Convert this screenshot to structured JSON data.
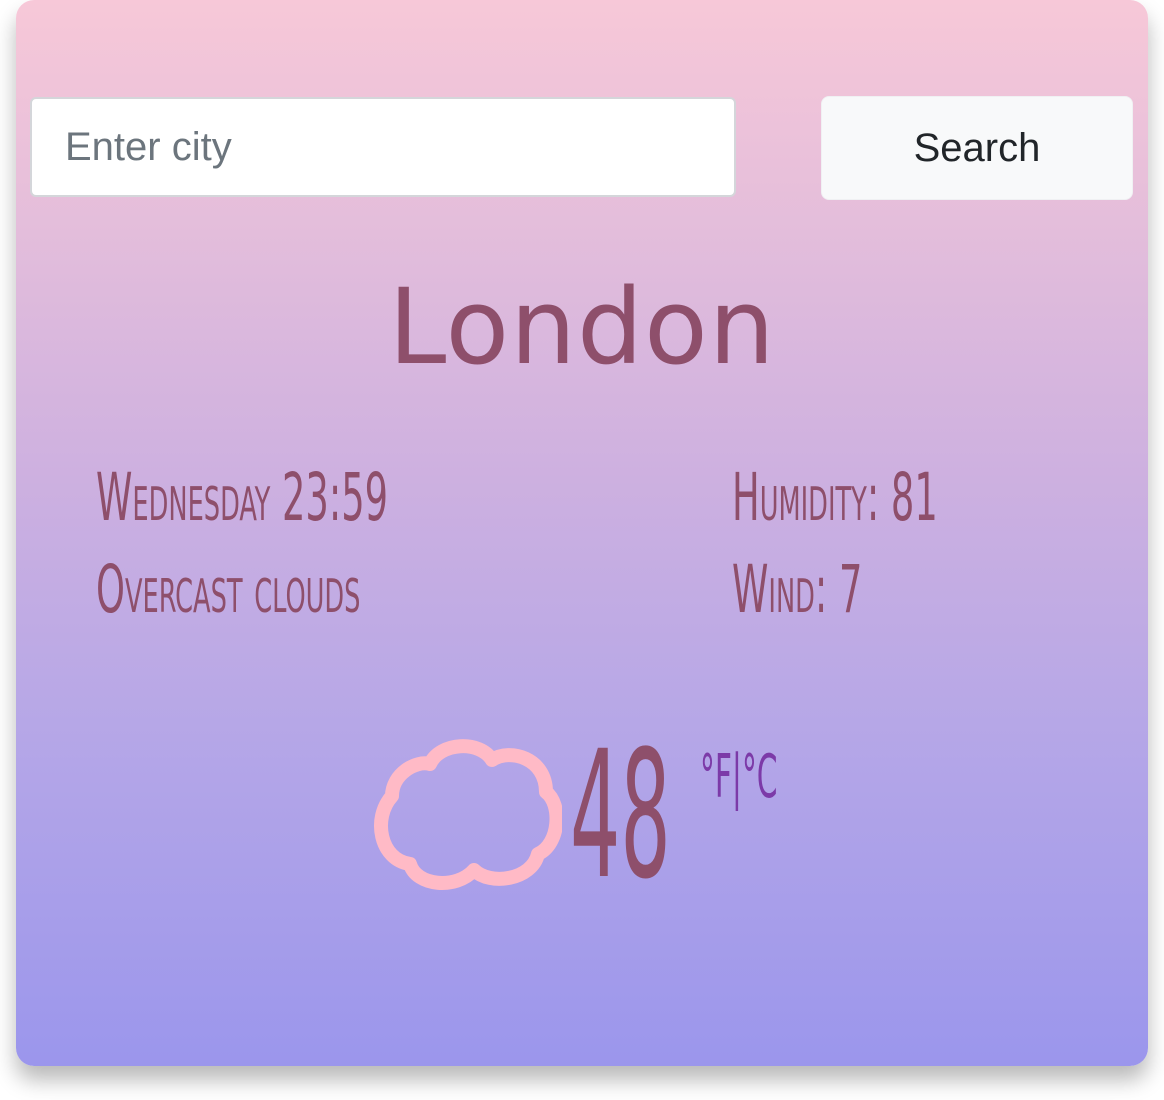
{
  "search": {
    "placeholder": "Enter city",
    "value": "",
    "button_label": "Search"
  },
  "weather": {
    "city": "London",
    "day_time": "Wednesday 23:59",
    "description": "Overcast clouds",
    "humidity_label": "Humidity: 81",
    "wind_label": "Wind: 7",
    "temperature": "48",
    "unit_f": "°F",
    "unit_separator": "|",
    "unit_c": "°C",
    "icon": "cloud-icon"
  },
  "colors": {
    "text_primary": "#8e4f6b",
    "unit_links": "#7c3aa8",
    "cloud_outline": "#ffbac6",
    "gradient_top": "#f7c8d8",
    "gradient_bottom": "#9b96ec"
  }
}
